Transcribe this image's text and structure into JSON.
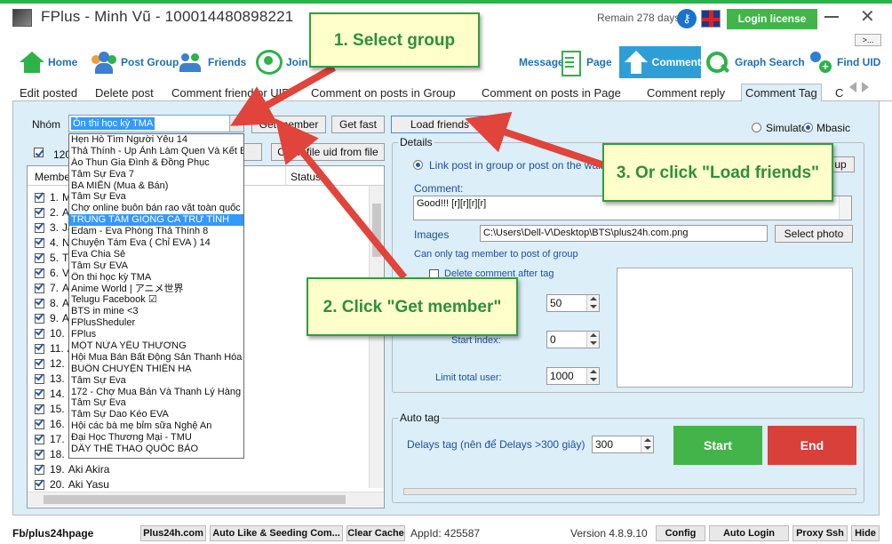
{
  "window": {
    "title": "FPlus - Minh Vũ - 100014480898221",
    "remain": "Remain 278 days",
    "login_label": "Login license",
    "more_label": ">..."
  },
  "nav": {
    "home": "Home",
    "post_group": "Post Group",
    "friends": "Friends",
    "join": "Join",
    "message": "Message",
    "page": "Page",
    "comment": "Comment",
    "graph_search": "Graph Search",
    "find_uid": "Find UID"
  },
  "tabs": [
    "Edit posted",
    "Delete post",
    "Comment friend or UID",
    "Comment on posts in Group",
    "Comment on posts in Page",
    "Comment reply",
    "Comment Tag",
    "C"
  ],
  "left": {
    "nhom_label": "Nhóm",
    "selected_group": "Ôn thi học kỳ TMA",
    "get_member": "Get member",
    "get_fast": "Get fast",
    "load_friends": "Load friends",
    "count_label": "120",
    "open_uid": "Open file uid from file",
    "col_member": "Member",
    "col_status": "Status",
    "members": [
      {
        "idx": "1.",
        "name": "M"
      },
      {
        "idx": "2.",
        "name": "A"
      },
      {
        "idx": "3.",
        "name": "Ja"
      },
      {
        "idx": "4.",
        "name": "N"
      },
      {
        "idx": "5.",
        "name": "T"
      },
      {
        "idx": "6.",
        "name": "V"
      },
      {
        "idx": "7.",
        "name": "A"
      },
      {
        "idx": "8.",
        "name": "A"
      },
      {
        "idx": "9.",
        "name": "A"
      },
      {
        "idx": "10.",
        "name": "A"
      },
      {
        "idx": "11.",
        "name": "A"
      },
      {
        "idx": "12.",
        "name": "A"
      },
      {
        "idx": "13.",
        "name": "A"
      },
      {
        "idx": "14.",
        "name": "A"
      },
      {
        "idx": "15.",
        "name": "A"
      },
      {
        "idx": "16.",
        "name": "A"
      },
      {
        "idx": "17.",
        "name": "A"
      },
      {
        "idx": "18.",
        "name": "A"
      },
      {
        "idx": "19.",
        "name": "Aki Akira"
      },
      {
        "idx": "20.",
        "name": "Aki Yasu"
      }
    ]
  },
  "dropdown": [
    "Hẹn Hò Tìm Người Yêu 14",
    "Thả Thính - Up Ảnh Làm Quen Và Kết Bạn",
    "Áo Thun Gia Đình & Đồng Phục",
    "Tâm Sự Eva 7",
    "BA MIỀN (Mua & Bán)",
    "Tâm Sự Eva",
    "Chợ online buôn bán rao vặt toàn quốc ♥",
    "TRUNG TÂM GIỌNG CA TRỮ TÌNH",
    "Edam - Eva Phòng Thả Thính 8",
    "Chuyện Tám Eva ( Chỉ EVA ) 14",
    "Eva Chia Sẻ",
    "Tâm Sự EVA",
    "Ôn thi học kỳ TMA",
    "Anime World | アニメ世界",
    "Telugu Facebook ☑",
    "BTS in mine <3",
    "FPlusSheduler",
    "FPlus",
    "MỘT NỬA YÊU THƯƠNG",
    "Hội Mua Bán Bất Động Sản Thanh Hóa",
    "BUÔN CHUYỆN THIÊN HẠ",
    "Tâm Sự Eva",
    "172 - Chợ Mua Bán Và Thanh Lý Hàng H",
    "Tâm Sự Eva",
    "Tâm Sự Dao Kéo EVA",
    "Hội các bà mẹ bỉm sữa Nghệ An",
    "Đại Học Thương Mại - TMU",
    "DÂY THỂ THAO QUỐC BẢO"
  ],
  "dropdown_selected_index": 7,
  "right": {
    "simulator": "Simulator",
    "mbasic": "Mbasic",
    "details_title": "Details",
    "link_post": "Link post in group or post on the wall",
    "up_btn": "up",
    "comment_label": "Comment:",
    "comment_value": "Good!!! [r][r][r][r]",
    "images_label": "Images",
    "images_value": "C:\\Users\\Dell-V\\Desktop\\BTS\\plus24h.com.png",
    "select_photo": "Select photo",
    "can_only_tag": "Can only tag member to post of group",
    "delete_after_tag": "Delete comment after tag",
    "spin_50": "50",
    "start_index_label": "Start index:",
    "spin_0": "0",
    "limit_label": "Limit total user:",
    "spin_1000": "1000",
    "autotag_title": "Auto tag",
    "delays_label": "Delays tag (nên để Delays >300  giây)",
    "delays_value": "300",
    "start": "Start",
    "end": "End"
  },
  "status": {
    "fb": "Fb/plus24hpage",
    "plus24h": "Plus24h.com",
    "autolike": "Auto Like & Seeding Com...",
    "clear_cache": "Clear Cache",
    "appid": "AppId: 425587",
    "version": "Version 4.8.9.10",
    "config": "Config",
    "auto_login": "Auto Login",
    "proxy": "Proxy Ssh",
    "hide": "Hide"
  },
  "annotations": {
    "step1": "1. Select group",
    "step2": "2. Click \"Get member\"",
    "step3": "3. Or click \"Load friends\""
  }
}
